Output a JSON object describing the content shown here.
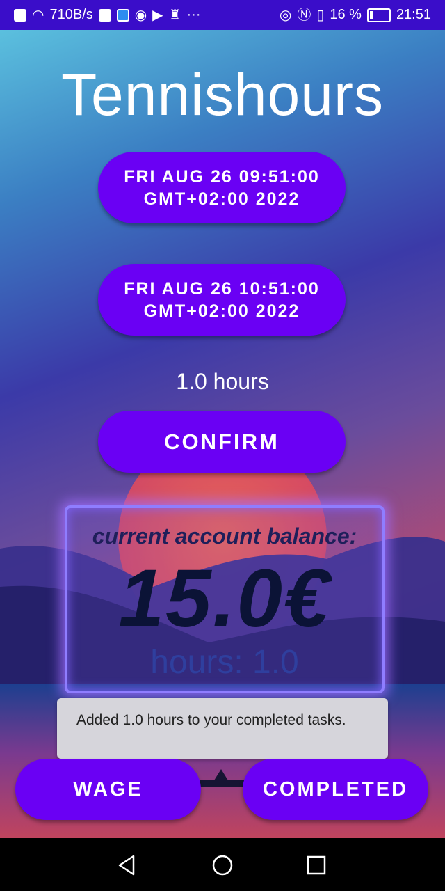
{
  "status_bar": {
    "net_speed": "710B/s",
    "battery_percent": "16 %",
    "time": "21:51",
    "more_indicator": "···"
  },
  "app": {
    "title": "Tennishours"
  },
  "start_time_button": {
    "line1": "FRI AUG 26 09:51:00",
    "line2": "GMT+02:00 2022"
  },
  "end_time_button": {
    "line1": "FRI AUG 26 10:51:00",
    "line2": "GMT+02:00 2022"
  },
  "duration_text": "1.0 hours",
  "confirm_label": "CONFIRM",
  "balance_card": {
    "label": "current account balance:",
    "amount": "15.0€",
    "hours": "hours: 1.0"
  },
  "toast": {
    "message": "Added 1.0 hours to your completed tasks."
  },
  "bottom_buttons": {
    "wage_label": "WAGE",
    "completed_label": "COMPLETED"
  },
  "colors": {
    "accent": "#6a00f4",
    "status_bar": "#3a0dc9"
  }
}
